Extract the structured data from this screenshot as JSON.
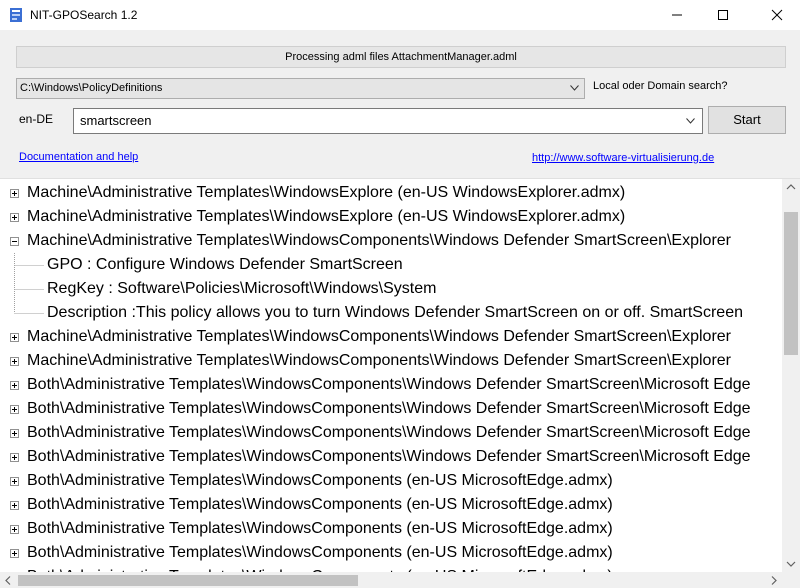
{
  "window": {
    "title": "NIT-GPOSearch 1.2",
    "icon": "gpo-search-app-icon",
    "controls": [
      "minimize-icon",
      "maximize-icon",
      "close-icon"
    ]
  },
  "status": {
    "text": "Processing adml files AttachmentManager.adml"
  },
  "path": {
    "value": "C:\\Windows\\PolicyDefinitions"
  },
  "scope": {
    "label": "Local oder Domain search?"
  },
  "search": {
    "language": "en-DE",
    "value": "smartscreen",
    "button_label": "Start"
  },
  "links": {
    "documentation": "Documentation and help",
    "website": "http://www.software-virtualisierung.de"
  },
  "tree": {
    "rows": [
      {
        "type": "node",
        "state": "collapsed",
        "text": "Machine\\Administrative Templates\\WindowsExplore   (en-US WindowsExplorer.admx)"
      },
      {
        "type": "node",
        "state": "collapsed",
        "text": "Machine\\Administrative Templates\\WindowsExplore   (en-US WindowsExplorer.admx)"
      },
      {
        "type": "node",
        "state": "expanded",
        "text": "Machine\\Administrative Templates\\WindowsComponents\\Windows Defender SmartScreen\\Explorer"
      },
      {
        "type": "child",
        "text": "GPO : Configure Windows Defender SmartScreen"
      },
      {
        "type": "child",
        "text": "RegKey : Software\\Policies\\Microsoft\\Windows\\System"
      },
      {
        "type": "child",
        "text": "Description :This policy allows you to turn Windows Defender SmartScreen on or off.  SmartScreen"
      },
      {
        "type": "node",
        "state": "collapsed",
        "text": "Machine\\Administrative Templates\\WindowsComponents\\Windows Defender SmartScreen\\Explorer"
      },
      {
        "type": "node",
        "state": "collapsed",
        "text": "Machine\\Administrative Templates\\WindowsComponents\\Windows Defender SmartScreen\\Explorer"
      },
      {
        "type": "node",
        "state": "collapsed",
        "text": "Both\\Administrative Templates\\WindowsComponents\\Windows Defender SmartScreen\\Microsoft Edge"
      },
      {
        "type": "node",
        "state": "collapsed",
        "text": "Both\\Administrative Templates\\WindowsComponents\\Windows Defender SmartScreen\\Microsoft Edge"
      },
      {
        "type": "node",
        "state": "collapsed",
        "text": "Both\\Administrative Templates\\WindowsComponents\\Windows Defender SmartScreen\\Microsoft Edge"
      },
      {
        "type": "node",
        "state": "collapsed",
        "text": "Both\\Administrative Templates\\WindowsComponents\\Windows Defender SmartScreen\\Microsoft Edge"
      },
      {
        "type": "node",
        "state": "collapsed",
        "text": "Both\\Administrative Templates\\WindowsComponents   (en-US MicrosoftEdge.admx)"
      },
      {
        "type": "node",
        "state": "collapsed",
        "text": "Both\\Administrative Templates\\WindowsComponents   (en-US MicrosoftEdge.admx)"
      },
      {
        "type": "node",
        "state": "collapsed",
        "text": "Both\\Administrative Templates\\WindowsComponents   (en-US MicrosoftEdge.admx)"
      },
      {
        "type": "node",
        "state": "collapsed",
        "text": "Both\\Administrative Templates\\WindowsComponents   (en-US MicrosoftEdge.admx)"
      },
      {
        "type": "node",
        "state": "collapsed",
        "text": "Both\\Administrative Templates\\WindowsComponents   (en-US MicrosoftEdge.admx)"
      }
    ]
  }
}
